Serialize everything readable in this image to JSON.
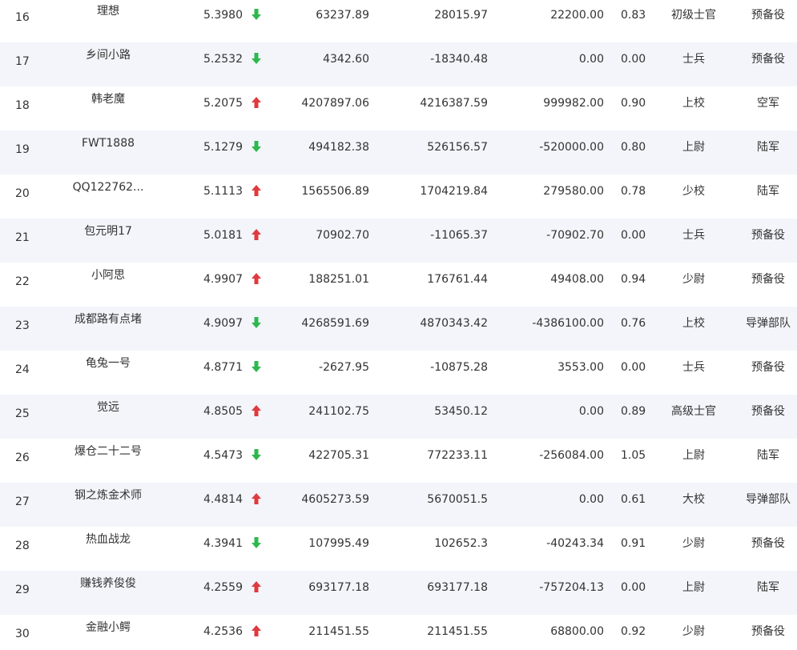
{
  "rows": [
    {
      "rank": "16",
      "name": "理想",
      "score": "5.3980",
      "trend": "down",
      "v1": "63237.89",
      "v2": "28015.97",
      "v3": "22200.00",
      "ratio": "0.83",
      "title": "初级士官",
      "branch": "预备役"
    },
    {
      "rank": "17",
      "name": "乡间小路",
      "score": "5.2532",
      "trend": "down",
      "v1": "4342.60",
      "v2": "-18340.48",
      "v3": "0.00",
      "ratio": "0.00",
      "title": "士兵",
      "branch": "预备役"
    },
    {
      "rank": "18",
      "name": "韩老魔",
      "score": "5.2075",
      "trend": "up",
      "v1": "4207897.06",
      "v2": "4216387.59",
      "v3": "999982.00",
      "ratio": "0.90",
      "title": "上校",
      "branch": "空军"
    },
    {
      "rank": "19",
      "name": "FWT1888",
      "score": "5.1279",
      "trend": "down",
      "v1": "494182.38",
      "v2": "526156.57",
      "v3": "-520000.00",
      "ratio": "0.80",
      "title": "上尉",
      "branch": "陆军"
    },
    {
      "rank": "20",
      "name": "QQ122762...",
      "score": "5.1113",
      "trend": "up",
      "v1": "1565506.89",
      "v2": "1704219.84",
      "v3": "279580.00",
      "ratio": "0.78",
      "title": "少校",
      "branch": "陆军"
    },
    {
      "rank": "21",
      "name": "包元明17",
      "score": "5.0181",
      "trend": "up",
      "v1": "70902.70",
      "v2": "-11065.37",
      "v3": "-70902.70",
      "ratio": "0.00",
      "title": "士兵",
      "branch": "预备役"
    },
    {
      "rank": "22",
      "name": "小阿思",
      "score": "4.9907",
      "trend": "up",
      "v1": "188251.01",
      "v2": "176761.44",
      "v3": "49408.00",
      "ratio": "0.94",
      "title": "少尉",
      "branch": "预备役"
    },
    {
      "rank": "23",
      "name": "成都路有点堵",
      "score": "4.9097",
      "trend": "down",
      "v1": "4268591.69",
      "v2": "4870343.42",
      "v3": "-4386100.00",
      "ratio": "0.76",
      "title": "上校",
      "branch": "导弹部队"
    },
    {
      "rank": "24",
      "name": "龟兔一号",
      "score": "4.8771",
      "trend": "down",
      "v1": "-2627.95",
      "v2": "-10875.28",
      "v3": "3553.00",
      "ratio": "0.00",
      "title": "士兵",
      "branch": "预备役"
    },
    {
      "rank": "25",
      "name": "觉远",
      "score": "4.8505",
      "trend": "up",
      "v1": "241102.75",
      "v2": "53450.12",
      "v3": "0.00",
      "ratio": "0.89",
      "title": "高级士官",
      "branch": "预备役"
    },
    {
      "rank": "26",
      "name": "爆仓二十二号",
      "score": "4.5473",
      "trend": "down",
      "v1": "422705.31",
      "v2": "772233.11",
      "v3": "-256084.00",
      "ratio": "1.05",
      "title": "上尉",
      "branch": "陆军"
    },
    {
      "rank": "27",
      "name": "钢之炼金术师",
      "score": "4.4814",
      "trend": "up",
      "v1": "4605273.59",
      "v2": "5670051.5",
      "v3": "0.00",
      "ratio": "0.61",
      "title": "大校",
      "branch": "导弹部队"
    },
    {
      "rank": "28",
      "name": "热血战龙",
      "score": "4.3941",
      "trend": "down",
      "v1": "107995.49",
      "v2": "102652.3",
      "v3": "-40243.34",
      "ratio": "0.91",
      "title": "少尉",
      "branch": "预备役"
    },
    {
      "rank": "29",
      "name": "赚钱养俊俊",
      "score": "4.2559",
      "trend": "up",
      "v1": "693177.18",
      "v2": "693177.18",
      "v3": "-757204.13",
      "ratio": "0.00",
      "title": "上尉",
      "branch": "陆军"
    },
    {
      "rank": "30",
      "name": "金融小鳄",
      "score": "4.2536",
      "trend": "up",
      "v1": "211451.55",
      "v2": "211451.55",
      "v3": "68800.00",
      "ratio": "0.92",
      "title": "少尉",
      "branch": "预备役"
    }
  ],
  "icons": {
    "up": "arrow-up-icon",
    "down": "arrow-down-icon"
  },
  "colors": {
    "up": "#e0393e",
    "down": "#2db84d",
    "row_alt_background": "#f3f5fa"
  }
}
